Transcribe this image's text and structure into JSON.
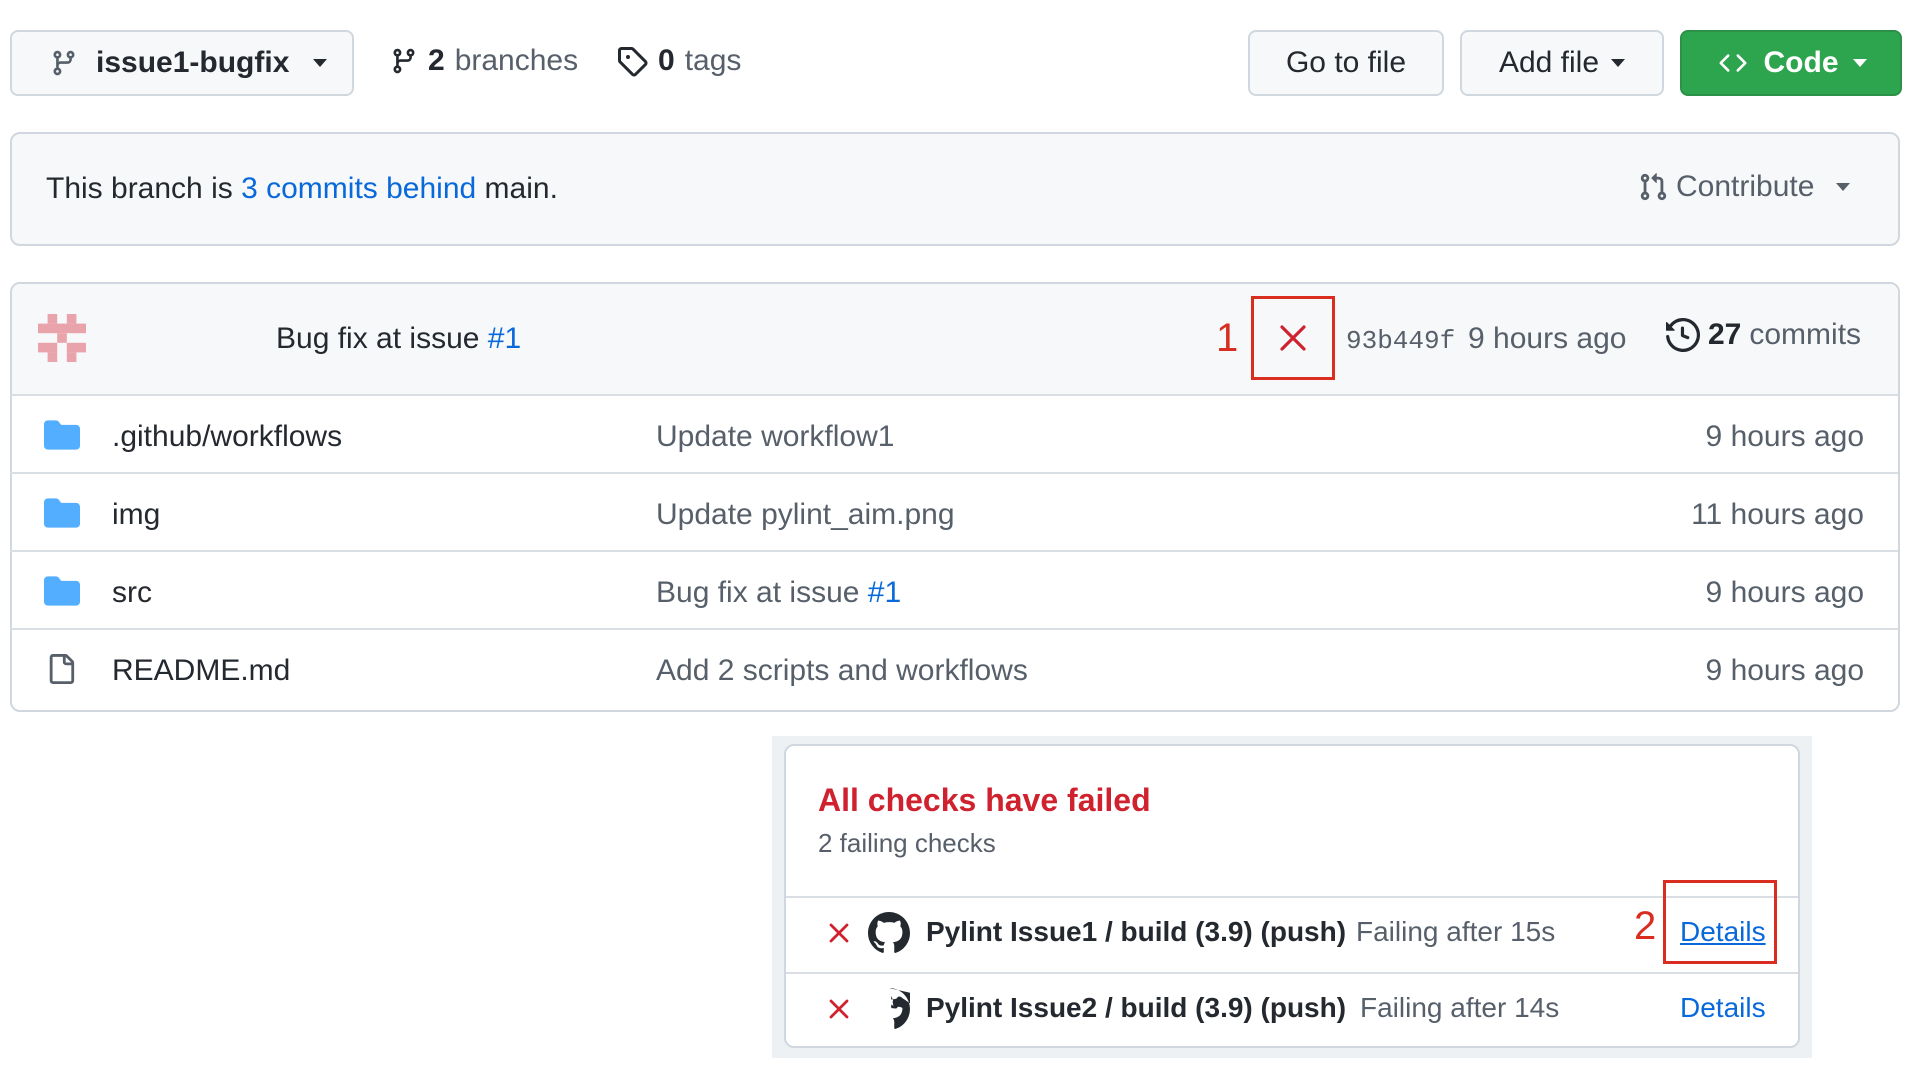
{
  "toolbar": {
    "branch_name": "issue1-bugfix",
    "branches_count": "2",
    "branches_label": "branches",
    "tags_count": "0",
    "tags_label": "tags",
    "go_to_file": "Go to file",
    "add_file": "Add file",
    "code": "Code"
  },
  "branch_info": {
    "text_before": "This branch is",
    "link": "3 commits behind",
    "text_after": "main.",
    "contribute": "Contribute"
  },
  "latest_commit": {
    "message": "Bug fix at issue",
    "issue_ref": "#1",
    "hash": "93b449f",
    "age": "9 hours ago",
    "commits_count": "27",
    "commits_label": "commits"
  },
  "files": [
    {
      "name": ".github/workflows",
      "type": "folder",
      "message": "Update workflow1",
      "message_ref": "",
      "age": "9 hours ago"
    },
    {
      "name": "img",
      "type": "folder",
      "message": "Update pylint_aim.png",
      "message_ref": "",
      "age": "11 hours ago"
    },
    {
      "name": "src",
      "type": "folder",
      "message": "Bug fix at issue",
      "message_ref": "#1",
      "age": "9 hours ago"
    },
    {
      "name": "README.md",
      "type": "file",
      "message": "Add 2 scripts and workflows",
      "message_ref": "",
      "age": "9 hours ago"
    }
  ],
  "checks_popup": {
    "title": "All checks have failed",
    "subtitle": "2 failing checks",
    "checks": [
      {
        "name": "Pylint Issue1 / build (3.9) (push)",
        "status": "Failing after 15s",
        "details": "Details"
      },
      {
        "name": "Pylint Issue2 / build (3.9) (push)",
        "status": "Failing after 14s",
        "details": "Details"
      }
    ]
  },
  "annotations": {
    "marker_1": "1",
    "marker_2": "2"
  },
  "colors": {
    "code_button": "#2da44e",
    "link": "#0969da",
    "fail": "#cf222e",
    "folder": "#54aeff",
    "annotation": "#d92d20"
  }
}
